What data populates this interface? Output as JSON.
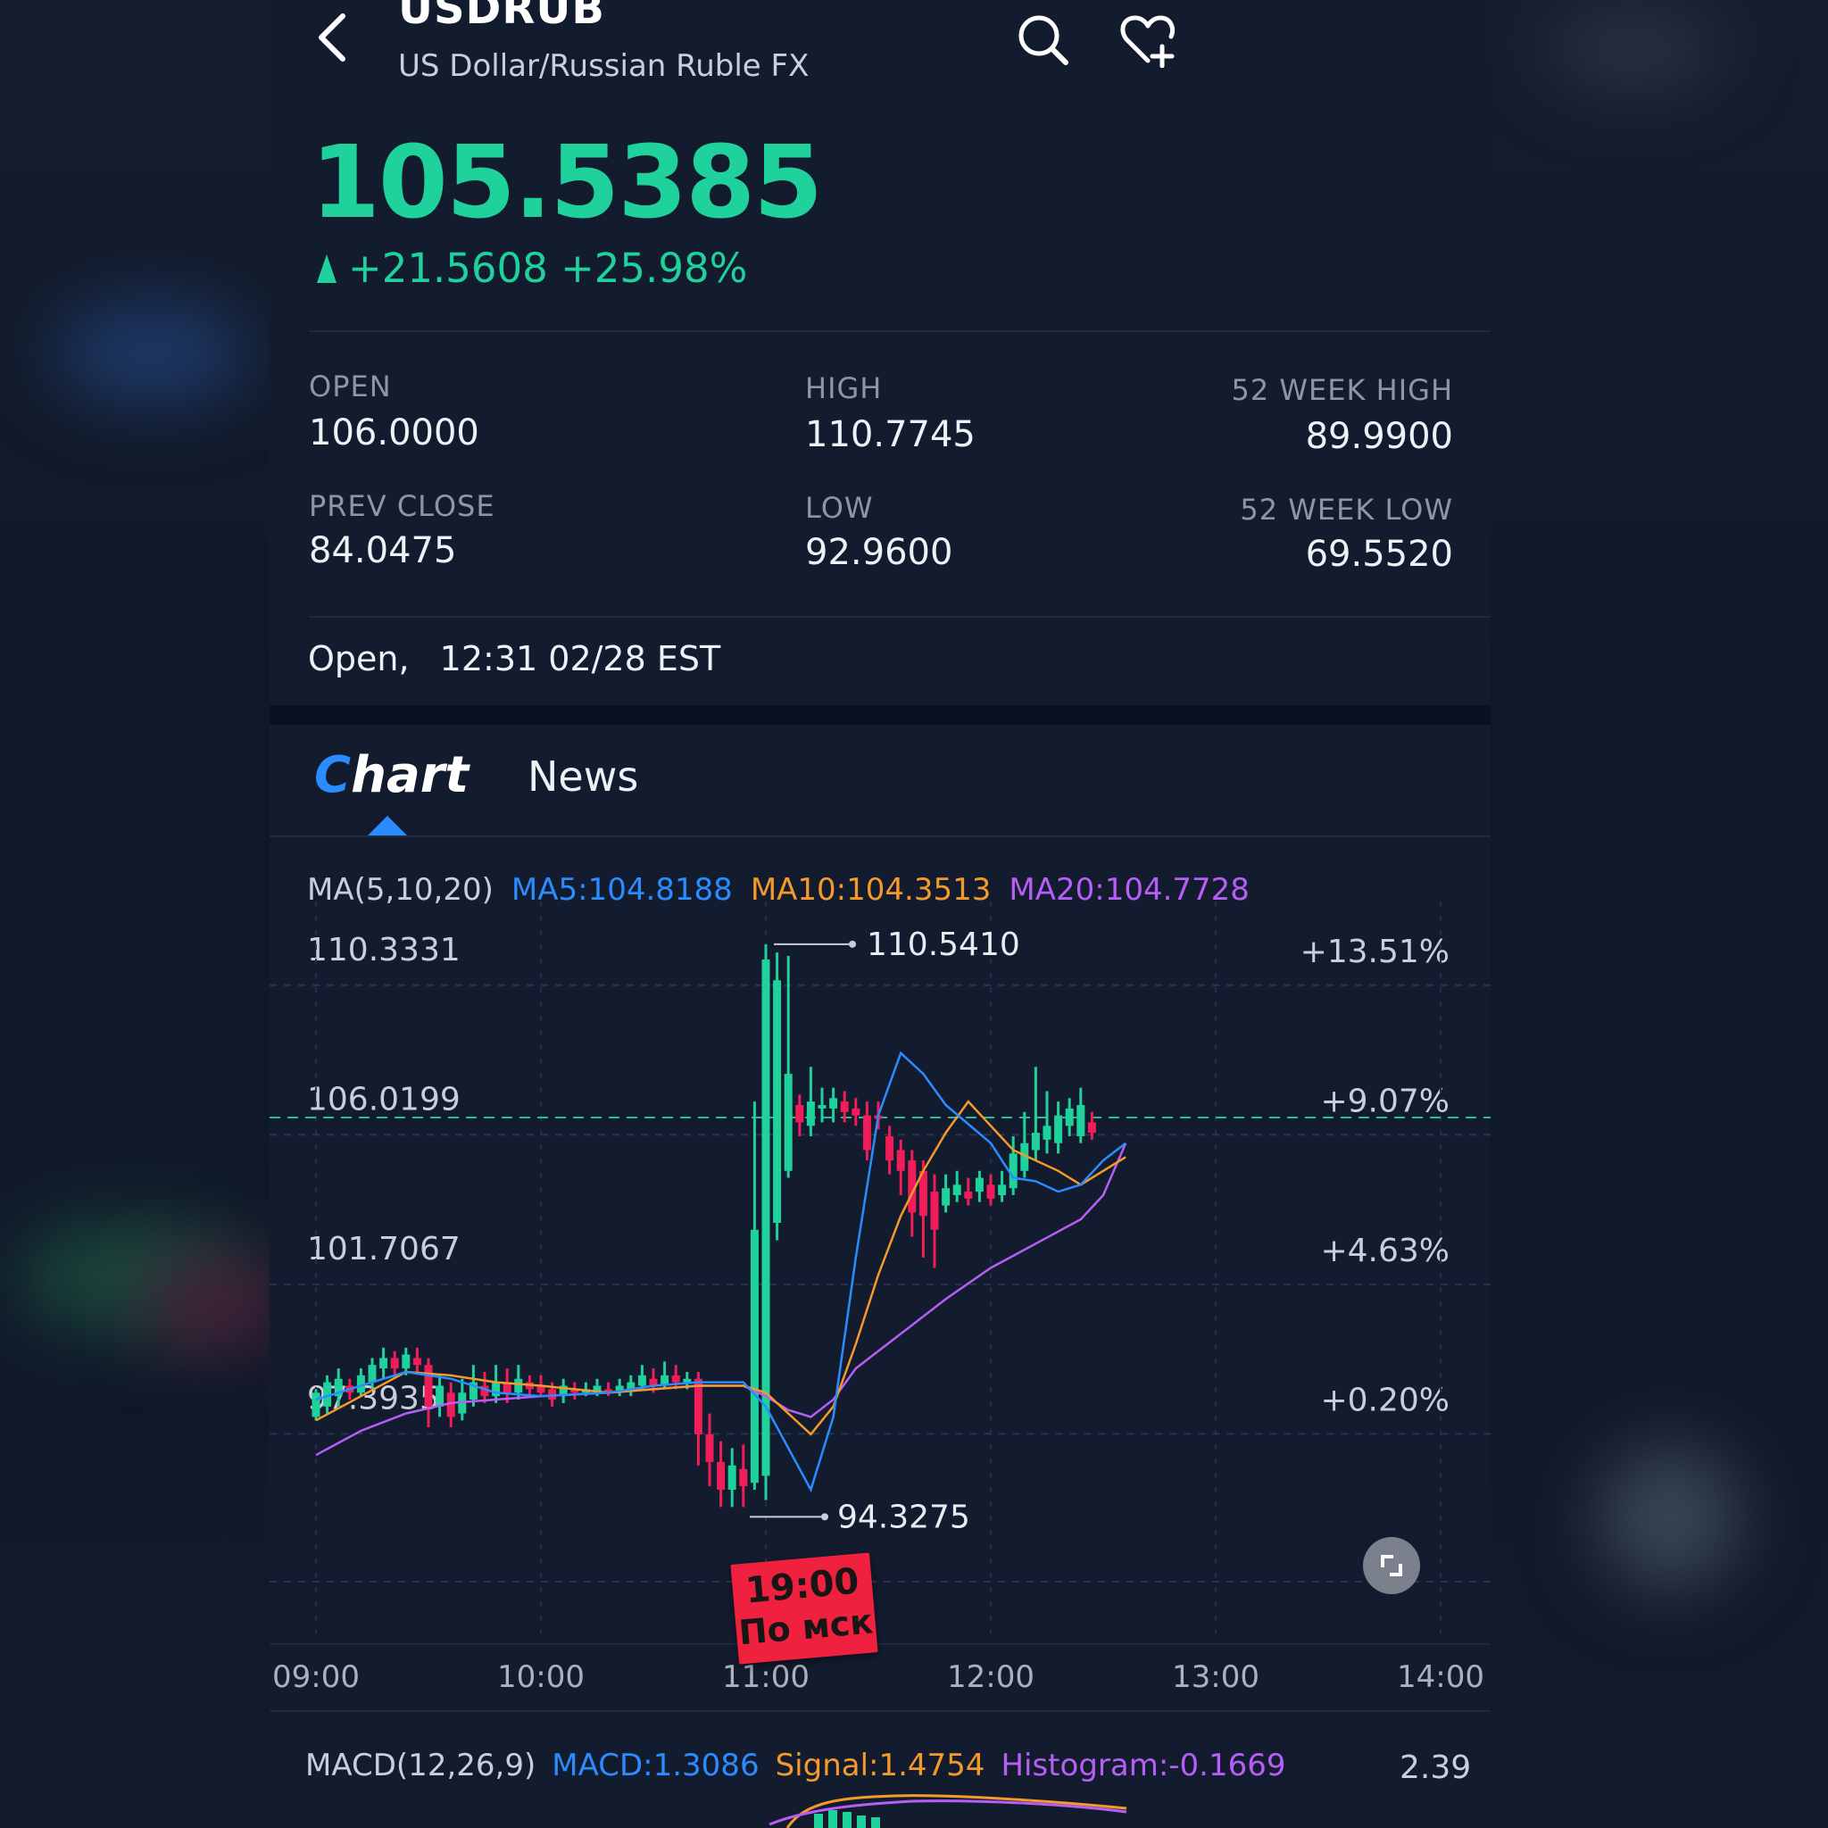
{
  "header": {
    "symbol": "USDRUB",
    "name": "US Dollar/Russian Ruble FX"
  },
  "quote": {
    "price": "105.5385",
    "change": "+21.5608 +25.98%",
    "direction": "up"
  },
  "stats": {
    "open_label": "OPEN",
    "open_value": "106.0000",
    "prev_close_label": "PREV CLOSE",
    "prev_close_value": "84.0475",
    "high_label": "HIGH",
    "high_value": "110.7745",
    "low_label": "LOW",
    "low_value": "92.9600",
    "week52_high_label": "52 WEEK HIGH",
    "week52_high_value": "89.9900",
    "week52_low_label": "52 WEEK LOW",
    "week52_low_value": "69.5520"
  },
  "status": {
    "state": "Open,",
    "time": "12:31 02/28 EST"
  },
  "tabs": {
    "chart_first": "C",
    "chart_rest": "hart",
    "news": "News",
    "active": "Chart"
  },
  "indicators": {
    "ma_label": "MA(5,10,20)",
    "ma5": "MA5:104.8188",
    "ma10": "MA10:104.3513",
    "ma20": "MA20:104.7728",
    "macd_label": "MACD(12,26,9)",
    "macd": "MACD:1.3086",
    "signal": "Signal:1.4754",
    "histogram": "Histogram:-0.1669",
    "macd_axis_value": "2.39"
  },
  "stamp": {
    "line1": "19:00",
    "line2": "По мск"
  },
  "colors": {
    "up": "#1fd19b",
    "down": "#f01e58",
    "ma5": "#2a8cff",
    "ma10": "#f39a2b",
    "ma20": "#b65ef5",
    "accent": "#2a8cff",
    "stamp": "#f0213f"
  },
  "chart_data": {
    "type": "candlestick",
    "x_ticks": [
      "09:00",
      "10:00",
      "11:00",
      "12:00",
      "13:00",
      "14:00"
    ],
    "y_ticks": [
      "110.3331",
      "106.0199",
      "101.7067",
      "97.3935"
    ],
    "pct_ticks": [
      "+13.51%",
      "+9.07%",
      "+4.63%",
      "+0.20%"
    ],
    "ylim": [
      93.1,
      111.0
    ],
    "reference_price": 105.5385,
    "max_marker": {
      "time": "11:05",
      "value": "110.5410"
    },
    "min_marker": {
      "time": "11:00",
      "value": "94.3275"
    },
    "candles": [
      [
        "09:00",
        96.9,
        97.6,
        96.8,
        97.7
      ],
      [
        "09:03",
        97.2,
        97.9,
        97.0,
        98.1
      ],
      [
        "09:06",
        97.5,
        98.0,
        97.2,
        98.3
      ],
      [
        "09:09",
        97.8,
        97.6,
        97.4,
        98.0
      ],
      [
        "09:12",
        97.6,
        98.1,
        97.5,
        98.3
      ],
      [
        "09:15",
        97.9,
        98.4,
        97.7,
        98.6
      ],
      [
        "09:18",
        98.3,
        98.6,
        98.0,
        98.9
      ],
      [
        "09:21",
        98.6,
        98.3,
        98.0,
        98.8
      ],
      [
        "09:24",
        98.3,
        98.7,
        98.1,
        98.9
      ],
      [
        "09:27",
        98.6,
        98.4,
        98.2,
        98.9
      ],
      [
        "09:30",
        98.4,
        97.2,
        96.6,
        98.6
      ],
      [
        "09:33",
        97.2,
        97.8,
        96.9,
        98.1
      ],
      [
        "09:36",
        97.6,
        96.9,
        96.6,
        97.9
      ],
      [
        "09:39",
        97.0,
        97.6,
        96.8,
        98.0
      ],
      [
        "09:42",
        97.4,
        97.9,
        97.2,
        98.4
      ],
      [
        "09:45",
        97.8,
        97.5,
        97.3,
        98.2
      ],
      [
        "09:48",
        97.5,
        97.9,
        97.3,
        98.4
      ],
      [
        "09:51",
        97.9,
        97.6,
        97.3,
        98.3
      ],
      [
        "09:54",
        97.6,
        98.0,
        97.4,
        98.4
      ],
      [
        "09:57",
        97.9,
        97.7,
        97.5,
        98.1
      ],
      [
        "10:00",
        97.8,
        97.6,
        97.5,
        98.1
      ],
      [
        "10:03",
        97.7,
        97.4,
        97.2,
        97.9
      ],
      [
        "10:06",
        97.5,
        97.8,
        97.3,
        98.0
      ],
      [
        "10:09",
        97.7,
        97.6,
        97.4,
        97.9
      ],
      [
        "10:12",
        97.6,
        97.7,
        97.5,
        97.9
      ],
      [
        "10:15",
        97.6,
        97.8,
        97.5,
        98.0
      ],
      [
        "10:18",
        97.7,
        97.6,
        97.5,
        97.9
      ],
      [
        "10:21",
        97.6,
        97.8,
        97.5,
        98.0
      ],
      [
        "10:24",
        97.7,
        97.9,
        97.5,
        98.1
      ],
      [
        "10:27",
        97.8,
        98.1,
        97.7,
        98.4
      ],
      [
        "10:30",
        98.0,
        97.8,
        97.6,
        98.3
      ],
      [
        "10:33",
        97.8,
        98.1,
        97.7,
        98.5
      ],
      [
        "10:36",
        98.1,
        97.9,
        97.7,
        98.4
      ],
      [
        "10:39",
        97.9,
        98.0,
        97.7,
        98.2
      ],
      [
        "10:42",
        98.0,
        96.4,
        95.5,
        98.2
      ],
      [
        "10:45",
        96.4,
        95.6,
        94.9,
        97.0
      ],
      [
        "10:48",
        95.6,
        94.8,
        94.3,
        96.2
      ],
      [
        "10:51",
        94.8,
        95.5,
        94.3,
        96.0
      ],
      [
        "10:54",
        95.4,
        94.9,
        94.3,
        96.1
      ],
      [
        "10:57",
        95.0,
        102.3,
        94.8,
        106.0
      ],
      [
        "11:00",
        95.2,
        110.1,
        94.5,
        110.54
      ],
      [
        "11:03",
        102.5,
        109.5,
        102.0,
        110.3
      ],
      [
        "11:06",
        104.0,
        106.8,
        103.8,
        110.2
      ],
      [
        "11:09",
        105.9,
        105.4,
        105.0,
        106.2
      ],
      [
        "11:12",
        105.3,
        106.0,
        105.0,
        107.0
      ],
      [
        "11:15",
        105.8,
        105.9,
        105.4,
        106.4
      ],
      [
        "11:18",
        105.8,
        106.1,
        105.4,
        106.4
      ],
      [
        "11:21",
        106.0,
        105.7,
        105.4,
        106.3
      ],
      [
        "11:24",
        105.8,
        105.6,
        105.3,
        106.1
      ],
      [
        "11:27",
        105.6,
        104.6,
        104.3,
        106.0
      ],
      [
        "11:30",
        105.6,
        105.5,
        105.2,
        106.0
      ],
      [
        "11:33",
        105.0,
        104.3,
        103.9,
        105.3
      ],
      [
        "11:36",
        104.6,
        104.0,
        103.3,
        104.9
      ],
      [
        "11:39",
        104.3,
        102.8,
        102.1,
        104.6
      ],
      [
        "11:42",
        104.0,
        102.7,
        101.5,
        104.3
      ],
      [
        "11:45",
        103.4,
        102.3,
        101.2,
        103.9
      ],
      [
        "11:48",
        103.0,
        103.5,
        102.8,
        103.9
      ],
      [
        "11:51",
        103.3,
        103.6,
        103.1,
        104.0
      ],
      [
        "11:54",
        103.4,
        103.2,
        103.0,
        103.8
      ],
      [
        "11:57",
        103.4,
        103.8,
        103.1,
        104.0
      ],
      [
        "12:00",
        103.6,
        103.2,
        103.0,
        103.9
      ],
      [
        "12:03",
        103.3,
        103.6,
        103.1,
        104.0
      ],
      [
        "12:06",
        103.5,
        104.5,
        103.3,
        105.0
      ],
      [
        "12:09",
        104.0,
        104.8,
        103.8,
        105.7
      ],
      [
        "12:12",
        104.6,
        105.1,
        104.3,
        107.0
      ],
      [
        "12:15",
        104.9,
        105.3,
        104.5,
        106.3
      ],
      [
        "12:18",
        104.8,
        105.6,
        104.5,
        106.0
      ],
      [
        "12:21",
        105.3,
        105.8,
        105.0,
        106.1
      ],
      [
        "12:24",
        105.0,
        105.9,
        104.8,
        106.4
      ],
      [
        "12:27",
        105.4,
        105.1,
        104.9,
        105.7
      ]
    ],
    "ma5": [
      [
        0.0,
        97.4
      ],
      [
        0.2,
        97.8
      ],
      [
        0.4,
        98.2
      ],
      [
        0.6,
        98.0
      ],
      [
        0.8,
        97.6
      ],
      [
        1.0,
        97.5
      ],
      [
        1.3,
        97.6
      ],
      [
        1.5,
        97.8
      ],
      [
        1.7,
        97.9
      ],
      [
        1.9,
        97.9
      ],
      [
        2.0,
        97.2
      ],
      [
        2.1,
        96.0
      ],
      [
        2.2,
        94.8
      ],
      [
        2.3,
        96.9
      ],
      [
        2.4,
        101.5
      ],
      [
        2.5,
        105.6
      ],
      [
        2.6,
        107.4
      ],
      [
        2.7,
        106.8
      ],
      [
        2.8,
        105.9
      ],
      [
        3.0,
        104.8
      ],
      [
        3.1,
        103.8
      ],
      [
        3.2,
        103.7
      ],
      [
        3.3,
        103.4
      ],
      [
        3.4,
        103.6
      ],
      [
        3.5,
        104.3
      ],
      [
        3.6,
        104.8
      ]
    ],
    "ma10": [
      [
        0.0,
        96.8
      ],
      [
        0.2,
        97.5
      ],
      [
        0.4,
        98.2
      ],
      [
        0.6,
        98.1
      ],
      [
        0.8,
        97.9
      ],
      [
        1.0,
        97.8
      ],
      [
        1.3,
        97.6
      ],
      [
        1.5,
        97.7
      ],
      [
        1.7,
        97.8
      ],
      [
        1.9,
        97.8
      ],
      [
        2.0,
        97.6
      ],
      [
        2.1,
        97.0
      ],
      [
        2.2,
        96.4
      ],
      [
        2.3,
        97.2
      ],
      [
        2.4,
        99.0
      ],
      [
        2.5,
        101.0
      ],
      [
        2.6,
        102.7
      ],
      [
        2.7,
        104.0
      ],
      [
        2.8,
        105.1
      ],
      [
        2.9,
        106.0
      ],
      [
        3.0,
        105.3
      ],
      [
        3.1,
        104.6
      ],
      [
        3.3,
        104.0
      ],
      [
        3.4,
        103.6
      ],
      [
        3.5,
        104.0
      ],
      [
        3.6,
        104.4
      ]
    ],
    "ma20": [
      [
        0.0,
        95.8
      ],
      [
        0.2,
        96.5
      ],
      [
        0.4,
        97.0
      ],
      [
        0.6,
        97.3
      ],
      [
        0.8,
        97.4
      ],
      [
        1.0,
        97.5
      ],
      [
        1.3,
        97.6
      ],
      [
        1.5,
        97.7
      ],
      [
        1.7,
        97.8
      ],
      [
        1.9,
        97.8
      ],
      [
        2.0,
        97.5
      ],
      [
        2.1,
        97.1
      ],
      [
        2.2,
        96.9
      ],
      [
        2.3,
        97.4
      ],
      [
        2.4,
        98.3
      ],
      [
        2.6,
        99.3
      ],
      [
        2.8,
        100.3
      ],
      [
        3.0,
        101.2
      ],
      [
        3.2,
        101.9
      ],
      [
        3.4,
        102.6
      ],
      [
        3.5,
        103.3
      ],
      [
        3.6,
        104.8
      ]
    ]
  }
}
